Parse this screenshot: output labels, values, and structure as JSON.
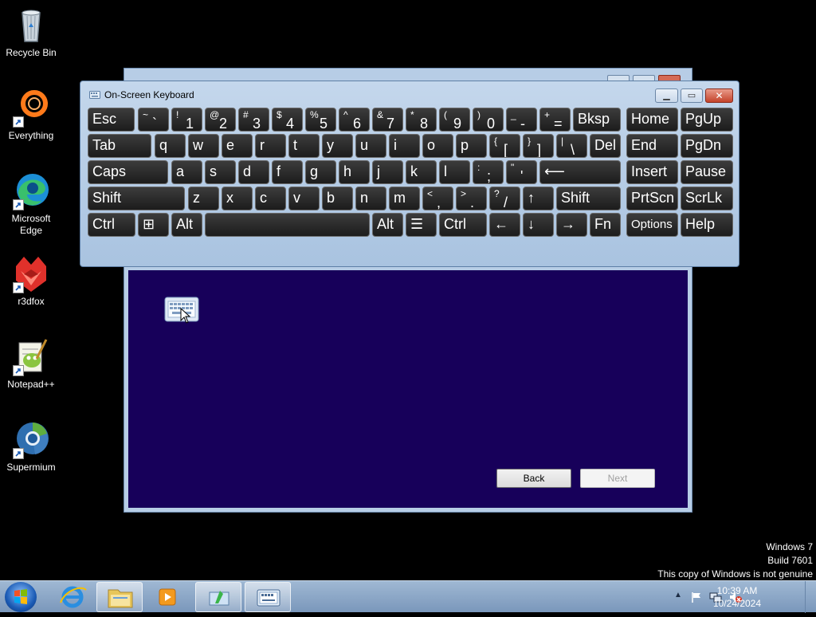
{
  "desktop_icons": [
    {
      "label": "Recycle Bin",
      "icon": "recycle-bin-icon"
    },
    {
      "label": "Everything",
      "icon": "everything-icon"
    },
    {
      "label": "Microsoft Edge",
      "icon": "edge-icon"
    },
    {
      "label": "r3dfox",
      "icon": "r3dfox-icon"
    },
    {
      "label": "Notepad++",
      "icon": "notepadpp-icon"
    },
    {
      "label": "Supermium",
      "icon": "supermium-icon"
    }
  ],
  "setup_window": {
    "back_label": "Back",
    "next_label": "Next"
  },
  "osk": {
    "title": "On-Screen Keyboard",
    "rows": [
      [
        {
          "main": "Esc"
        },
        {
          "shift": "~",
          "main": "`"
        },
        {
          "shift": "!",
          "main": "1"
        },
        {
          "shift": "@",
          "main": "2"
        },
        {
          "shift": "#",
          "main": "3"
        },
        {
          "shift": "$",
          "main": "4"
        },
        {
          "shift": "%",
          "main": "5"
        },
        {
          "shift": "^",
          "main": "6"
        },
        {
          "shift": "&",
          "main": "7"
        },
        {
          "shift": "*",
          "main": "8"
        },
        {
          "shift": "(",
          "main": "9"
        },
        {
          "shift": ")",
          "main": "0"
        },
        {
          "shift": "_",
          "main": "-"
        },
        {
          "shift": "+",
          "main": "="
        },
        {
          "main": "Bksp"
        },
        {
          "main": "Home"
        },
        {
          "main": "PgUp"
        }
      ],
      [
        {
          "main": "Tab"
        },
        {
          "main": "q"
        },
        {
          "main": "w"
        },
        {
          "main": "e"
        },
        {
          "main": "r"
        },
        {
          "main": "t"
        },
        {
          "main": "y"
        },
        {
          "main": "u"
        },
        {
          "main": "i"
        },
        {
          "main": "o"
        },
        {
          "main": "p"
        },
        {
          "shift": "{",
          "main": "["
        },
        {
          "shift": "}",
          "main": "]"
        },
        {
          "shift": "|",
          "main": "\\"
        },
        {
          "main": "Del"
        },
        {
          "main": "End"
        },
        {
          "main": "PgDn"
        }
      ],
      [
        {
          "main": "Caps"
        },
        {
          "main": "a"
        },
        {
          "main": "s"
        },
        {
          "main": "d"
        },
        {
          "main": "f"
        },
        {
          "main": "g"
        },
        {
          "main": "h"
        },
        {
          "main": "j"
        },
        {
          "main": "k"
        },
        {
          "main": "l"
        },
        {
          "shift": ":",
          "main": ";"
        },
        {
          "shift": "\"",
          "main": "'"
        },
        {
          "main": "⟵"
        },
        {
          "main": "Insert"
        },
        {
          "main": "Pause"
        }
      ],
      [
        {
          "main": "Shift"
        },
        {
          "main": "z"
        },
        {
          "main": "x"
        },
        {
          "main": "c"
        },
        {
          "main": "v"
        },
        {
          "main": "b"
        },
        {
          "main": "n"
        },
        {
          "main": "m"
        },
        {
          "shift": "<",
          "main": ","
        },
        {
          "shift": ">",
          "main": "."
        },
        {
          "shift": "?",
          "main": "/"
        },
        {
          "main": "↑"
        },
        {
          "main": "Shift"
        },
        {
          "main": "PrtScn"
        },
        {
          "main": "ScrLk"
        }
      ],
      [
        {
          "main": "Ctrl"
        },
        {
          "main": "⊞"
        },
        {
          "main": "Alt"
        },
        {
          "main": ""
        },
        {
          "main": "Alt"
        },
        {
          "main": "☰"
        },
        {
          "main": "Ctrl"
        },
        {
          "main": "←"
        },
        {
          "main": "↓"
        },
        {
          "main": "→"
        },
        {
          "main": "Fn"
        },
        {
          "main": "Options"
        },
        {
          "main": "Help"
        }
      ]
    ]
  },
  "watermark": {
    "line1": "Windows 7",
    "line2": "Build 7601",
    "line3": "This copy of Windows is not genuine"
  },
  "taskbar": {
    "items": [
      "start-orb-icon",
      "internet-explorer-icon",
      "file-explorer-icon",
      "media-player-icon",
      "setup-icon",
      "on-screen-keyboard-icon"
    ],
    "clock_time": "10:39 AM",
    "clock_date": "10/24/2024"
  }
}
